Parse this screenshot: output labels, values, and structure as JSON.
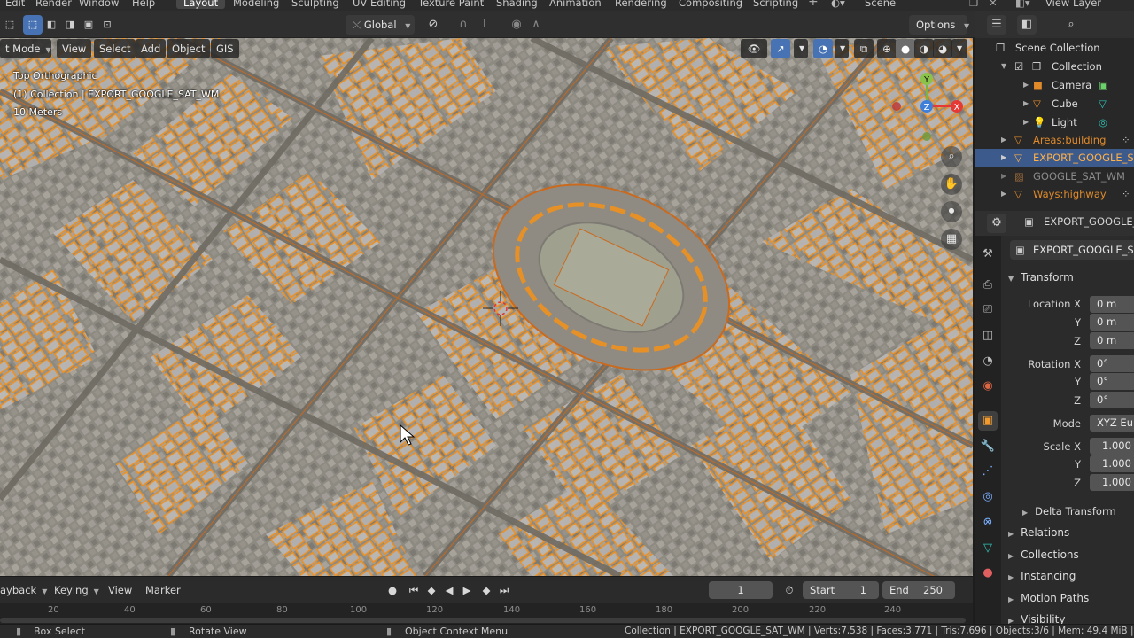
{
  "menu": {
    "items": [
      "Edit",
      "Render",
      "Window",
      "Help"
    ],
    "tabs": [
      "Layout",
      "Modeling",
      "Sculpting",
      "UV Editing",
      "Texture Paint",
      "Shading",
      "Animation",
      "Rendering",
      "Compositing",
      "Scripting"
    ],
    "active_tab": "Layout",
    "add_tab": "+",
    "scene": "Scene",
    "view_layer": "View Layer"
  },
  "viewport_header": {
    "transform_orientation": "Global",
    "options_label": "Options"
  },
  "viewport_menu": {
    "mode": "t Mode",
    "items": [
      "View",
      "Select",
      "Add",
      "Object",
      "GIS"
    ]
  },
  "viewport_overlay": {
    "view_name": "Top Orthographic",
    "collection_info": "(1) Collection | EXPORT_GOOGLE_SAT_WM",
    "scale": "10 Meters"
  },
  "gizmo": {
    "y": "Y",
    "z": "Z",
    "x": "X"
  },
  "outliner": {
    "title": "Scene Collection",
    "items": [
      {
        "label": "Collection"
      },
      {
        "label": "Camera"
      },
      {
        "label": "Cube"
      },
      {
        "label": "Light"
      },
      {
        "label": "Areas:building"
      },
      {
        "label": "EXPORT_GOOGLE_SAT"
      },
      {
        "label": "GOOGLE_SAT_WM"
      },
      {
        "label": "Ways:highway"
      }
    ]
  },
  "properties": {
    "object_name_header": "EXPORT_GOOGLE_S",
    "object_name_field": "EXPORT_GOOGLE_S",
    "transform_title": "Transform",
    "location": {
      "label": "Location X",
      "y": "Y",
      "z": "Z",
      "vx": "0 m",
      "vy": "0 m",
      "vz": "0 m"
    },
    "rotation": {
      "label": "Rotation X",
      "y": "Y",
      "z": "Z",
      "vx": "0°",
      "vy": "0°",
      "vz": "0°"
    },
    "mode": {
      "label": "Mode",
      "value": "XYZ Eule"
    },
    "scale": {
      "label": "Scale X",
      "y": "Y",
      "z": "Z",
      "vx": "1.000",
      "vy": "1.000",
      "vz": "1.000"
    },
    "sections": [
      "Delta Transform",
      "Relations",
      "Collections",
      "Instancing",
      "Motion Paths",
      "Visibility"
    ]
  },
  "timeline": {
    "playback": "ayback",
    "keying": "Keying",
    "view": "View",
    "marker": "Marker",
    "current_frame": "1",
    "start_label": "Start",
    "start": "1",
    "end_label": "End",
    "end": "250",
    "ticks": [
      "20",
      "40",
      "60",
      "80",
      "100",
      "120",
      "140",
      "160",
      "180",
      "200",
      "220",
      "240"
    ]
  },
  "status": {
    "box_select": "Box Select",
    "rotate_view": "Rotate View",
    "context_menu": "Object Context Menu",
    "stats": "Collection | EXPORT_GOOGLE_SAT_WM | Verts:7,538 | Faces:3,771 | Tris:7,696 | Objects:3/6 | Mem: 49.4 MiB |"
  },
  "colors": {
    "accent": "#4772b3",
    "building_outline": "#f0901e",
    "selection": "#3d5a8c"
  }
}
